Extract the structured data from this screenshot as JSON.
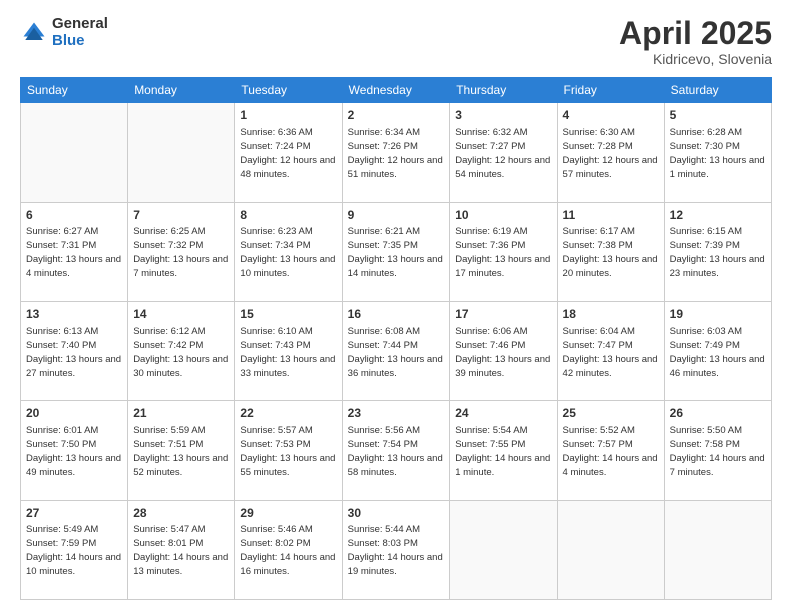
{
  "logo": {
    "general": "General",
    "blue": "Blue"
  },
  "header": {
    "month": "April 2025",
    "location": "Kidricevo, Slovenia"
  },
  "weekdays": [
    "Sunday",
    "Monday",
    "Tuesday",
    "Wednesday",
    "Thursday",
    "Friday",
    "Saturday"
  ],
  "weeks": [
    [
      {
        "day": "",
        "info": ""
      },
      {
        "day": "",
        "info": ""
      },
      {
        "day": "1",
        "info": "Sunrise: 6:36 AM\nSunset: 7:24 PM\nDaylight: 12 hours and 48 minutes."
      },
      {
        "day": "2",
        "info": "Sunrise: 6:34 AM\nSunset: 7:26 PM\nDaylight: 12 hours and 51 minutes."
      },
      {
        "day": "3",
        "info": "Sunrise: 6:32 AM\nSunset: 7:27 PM\nDaylight: 12 hours and 54 minutes."
      },
      {
        "day": "4",
        "info": "Sunrise: 6:30 AM\nSunset: 7:28 PM\nDaylight: 12 hours and 57 minutes."
      },
      {
        "day": "5",
        "info": "Sunrise: 6:28 AM\nSunset: 7:30 PM\nDaylight: 13 hours and 1 minute."
      }
    ],
    [
      {
        "day": "6",
        "info": "Sunrise: 6:27 AM\nSunset: 7:31 PM\nDaylight: 13 hours and 4 minutes."
      },
      {
        "day": "7",
        "info": "Sunrise: 6:25 AM\nSunset: 7:32 PM\nDaylight: 13 hours and 7 minutes."
      },
      {
        "day": "8",
        "info": "Sunrise: 6:23 AM\nSunset: 7:34 PM\nDaylight: 13 hours and 10 minutes."
      },
      {
        "day": "9",
        "info": "Sunrise: 6:21 AM\nSunset: 7:35 PM\nDaylight: 13 hours and 14 minutes."
      },
      {
        "day": "10",
        "info": "Sunrise: 6:19 AM\nSunset: 7:36 PM\nDaylight: 13 hours and 17 minutes."
      },
      {
        "day": "11",
        "info": "Sunrise: 6:17 AM\nSunset: 7:38 PM\nDaylight: 13 hours and 20 minutes."
      },
      {
        "day": "12",
        "info": "Sunrise: 6:15 AM\nSunset: 7:39 PM\nDaylight: 13 hours and 23 minutes."
      }
    ],
    [
      {
        "day": "13",
        "info": "Sunrise: 6:13 AM\nSunset: 7:40 PM\nDaylight: 13 hours and 27 minutes."
      },
      {
        "day": "14",
        "info": "Sunrise: 6:12 AM\nSunset: 7:42 PM\nDaylight: 13 hours and 30 minutes."
      },
      {
        "day": "15",
        "info": "Sunrise: 6:10 AM\nSunset: 7:43 PM\nDaylight: 13 hours and 33 minutes."
      },
      {
        "day": "16",
        "info": "Sunrise: 6:08 AM\nSunset: 7:44 PM\nDaylight: 13 hours and 36 minutes."
      },
      {
        "day": "17",
        "info": "Sunrise: 6:06 AM\nSunset: 7:46 PM\nDaylight: 13 hours and 39 minutes."
      },
      {
        "day": "18",
        "info": "Sunrise: 6:04 AM\nSunset: 7:47 PM\nDaylight: 13 hours and 42 minutes."
      },
      {
        "day": "19",
        "info": "Sunrise: 6:03 AM\nSunset: 7:49 PM\nDaylight: 13 hours and 46 minutes."
      }
    ],
    [
      {
        "day": "20",
        "info": "Sunrise: 6:01 AM\nSunset: 7:50 PM\nDaylight: 13 hours and 49 minutes."
      },
      {
        "day": "21",
        "info": "Sunrise: 5:59 AM\nSunset: 7:51 PM\nDaylight: 13 hours and 52 minutes."
      },
      {
        "day": "22",
        "info": "Sunrise: 5:57 AM\nSunset: 7:53 PM\nDaylight: 13 hours and 55 minutes."
      },
      {
        "day": "23",
        "info": "Sunrise: 5:56 AM\nSunset: 7:54 PM\nDaylight: 13 hours and 58 minutes."
      },
      {
        "day": "24",
        "info": "Sunrise: 5:54 AM\nSunset: 7:55 PM\nDaylight: 14 hours and 1 minute."
      },
      {
        "day": "25",
        "info": "Sunrise: 5:52 AM\nSunset: 7:57 PM\nDaylight: 14 hours and 4 minutes."
      },
      {
        "day": "26",
        "info": "Sunrise: 5:50 AM\nSunset: 7:58 PM\nDaylight: 14 hours and 7 minutes."
      }
    ],
    [
      {
        "day": "27",
        "info": "Sunrise: 5:49 AM\nSunset: 7:59 PM\nDaylight: 14 hours and 10 minutes."
      },
      {
        "day": "28",
        "info": "Sunrise: 5:47 AM\nSunset: 8:01 PM\nDaylight: 14 hours and 13 minutes."
      },
      {
        "day": "29",
        "info": "Sunrise: 5:46 AM\nSunset: 8:02 PM\nDaylight: 14 hours and 16 minutes."
      },
      {
        "day": "30",
        "info": "Sunrise: 5:44 AM\nSunset: 8:03 PM\nDaylight: 14 hours and 19 minutes."
      },
      {
        "day": "",
        "info": ""
      },
      {
        "day": "",
        "info": ""
      },
      {
        "day": "",
        "info": ""
      }
    ]
  ]
}
